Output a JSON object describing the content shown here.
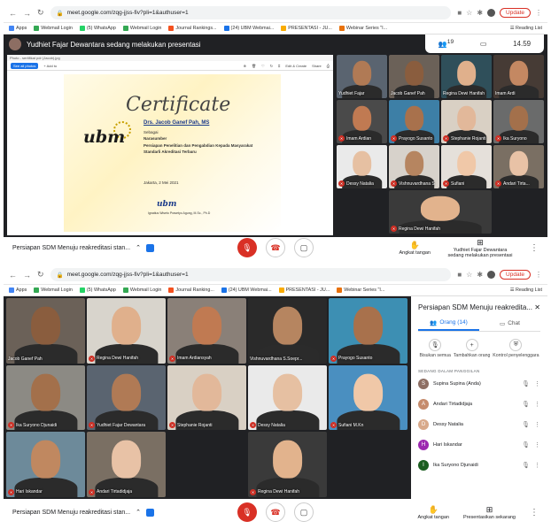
{
  "browser": {
    "url": "meet.google.com/zqg-jjss-fiv?pli=1&authuser=1",
    "update_label": "Update",
    "bookmarks": [
      "Apps",
      "Webmail Login",
      "(5) WhatsApp",
      "Webmail Login",
      "Journal Rankings...",
      "(24) UBM Webmai...",
      "PRESENTASI - JU...",
      "Webinar Series \"I..."
    ],
    "bookmarks2": [
      "Apps",
      "Webmail Login",
      "(5) WhatsApp",
      "Webmail Login",
      "Journal Ranking...",
      "(24) UBM Webmai...",
      "PRESENTASI - JU...",
      "Webinar Series \"I..."
    ],
    "reading_list": "Reading List"
  },
  "shot1": {
    "presenting_text": "Yudhiet Fajar Dewantara sedang melakukan presentasi",
    "time": "14.59",
    "participant_count": "19",
    "pdf_title": "Photo - sertifikat pdr (Jacob).jpg",
    "certificate": {
      "title": "Certificate",
      "recipient": "Drs. Jacob Ganef Pah, MS",
      "role": "Sebagai",
      "role_value": "Narasumber",
      "event_line1": "Persiapan Penelitian dan Pengabdian Kepada Masyarakat",
      "event_line2": "Standarli Akreditasi Terbaru",
      "date": "Jakarta, 2 Mei 2021",
      "logo": "ubm",
      "signer": "Ignatius Wiseto Prasetyo Agung, M.Sc., Ph.D"
    },
    "tiles": [
      {
        "name": "Yudhiet Fajar",
        "muted": false,
        "skin": "#b07a55",
        "bg": "#5a6470"
      },
      {
        "name": "Jacob Ganef Pah",
        "muted": false,
        "skin": "#8a5d3e",
        "bg": "#6b6158"
      },
      {
        "name": "Regina Dewi Hanifah",
        "muted": false,
        "skin": "#e0b08c",
        "bg": "#2f4f5a"
      },
      {
        "name": "Imam Ardi",
        "muted": false,
        "skin": "#c48862",
        "bg": "#463b35"
      },
      {
        "name": "Imam Ardian",
        "muted": true,
        "skin": "#c07a52",
        "bg": "#4a4a4a"
      },
      {
        "name": "Prayogo Susanto",
        "muted": true,
        "skin": "#a8714c",
        "bg": "#3d7fa6"
      },
      {
        "name": "Stephanie Rojanti",
        "muted": true,
        "skin": "#e2b89a",
        "bg": "#d9d0c4"
      },
      {
        "name": "Ika Suryono",
        "muted": true,
        "skin": "#a3704b",
        "bg": "#6a6b6b"
      },
      {
        "name": "Dessy Natalia",
        "muted": true,
        "skin": "#e6c0a2",
        "bg": "#eaeaea"
      },
      {
        "name": "Vishnuvardhana S",
        "muted": true,
        "skin": "#b68560",
        "bg": "#d7d2cb"
      },
      {
        "name": "Sufiani",
        "muted": true,
        "skin": "#f0c8a8",
        "bg": "#e5e0da"
      },
      {
        "name": "Andari Tirta...",
        "muted": true,
        "skin": "#e8c2a6",
        "bg": "#7a6f63"
      },
      {
        "name": "Regina Dewi Hanifah",
        "muted": true,
        "skin": "#e2b38d",
        "bg": "#3a3a3a"
      }
    ],
    "meeting_title": "Persiapan SDM Menuju reakreditasi stan...",
    "raise_hand": "Angkat tangan",
    "presenter_label": "Yudhiet Fajar Dewantara sedang melakukan presentasi"
  },
  "shot2": {
    "tiles": [
      {
        "name": "Jacob Ganef Pah",
        "muted": false,
        "skin": "#8a5d3e",
        "bg": "#6b6158"
      },
      {
        "name": "Regina Dewi Hanifah",
        "muted": true,
        "skin": "#e0b08c",
        "bg": "#d8d4cc"
      },
      {
        "name": "Imam Ardiansyah",
        "muted": true,
        "skin": "#c07a52",
        "bg": "#8a8078"
      },
      {
        "name": "Vishnuvardhana S.Soepr...",
        "muted": false,
        "skin": "#b68560",
        "bg": "#2a2a2a"
      },
      {
        "name": "Prayogo Susanto",
        "muted": true,
        "skin": "#a8714c",
        "bg": "#3d8fb3"
      },
      {
        "name": "Ika Suryono Djunaidi",
        "muted": true,
        "skin": "#a3704b",
        "bg": "#8c8a84"
      },
      {
        "name": "Yudhiet Fajar Dewantara",
        "muted": true,
        "skin": "#b07a55",
        "bg": "#5a6470"
      },
      {
        "name": "Stephanie Rojanti",
        "muted": true,
        "skin": "#e2b89a",
        "bg": "#d9d0c4"
      },
      {
        "name": "Dessy Natalia",
        "muted": true,
        "skin": "#e6c0a2",
        "bg": "#eaeaea"
      },
      {
        "name": "Sufiani M.Kn",
        "muted": true,
        "skin": "#f0c8a8",
        "bg": "#4a8fc0"
      },
      {
        "name": "Hari Iskandar",
        "muted": true,
        "skin": "#c08860",
        "bg": "#6d8a9a"
      },
      {
        "name": "Andari Tirtadidjaja",
        "muted": true,
        "skin": "#e8c2a6",
        "bg": "#7a6f63"
      },
      {
        "name": "",
        "muted": false,
        "skin": "#202124",
        "bg": "#202124"
      },
      {
        "name": "Regina Dewi Hanifah",
        "muted": true,
        "skin": "#e2b38d",
        "bg": "#3a3a3a"
      },
      {
        "name": "",
        "muted": false,
        "skin": "#202124",
        "bg": "#202124"
      }
    ],
    "panel": {
      "title": "Persiapan SDM Menuju reakredita...",
      "tab_people": "Orang (14)",
      "tab_chat": "Chat",
      "actions": [
        "Bisukan semua",
        "Tambahkan orang",
        "Kontrol penyelenggara"
      ],
      "section": "SEDANG DALAM PANGGILAN",
      "people": [
        {
          "name": "Supina Supina (Anda)",
          "initial": "S",
          "color": "#8d6e63"
        },
        {
          "name": "Andari Tirtadidjaja",
          "initial": "A",
          "color": "#c58b6c"
        },
        {
          "name": "Dessy Natalia",
          "initial": "D",
          "color": "#d8a98a"
        },
        {
          "name": "Hari Iskandar",
          "initial": "H",
          "color": "#9c27b0"
        },
        {
          "name": "Ika Suryono Djunaidi",
          "initial": "I",
          "color": "#1b5e20"
        }
      ]
    },
    "meeting_title": "Persiapan SDM Menuju reakreditasi stan...",
    "raise_hand": "Angkat tangan",
    "present_now": "Presentasikan sekarang"
  }
}
